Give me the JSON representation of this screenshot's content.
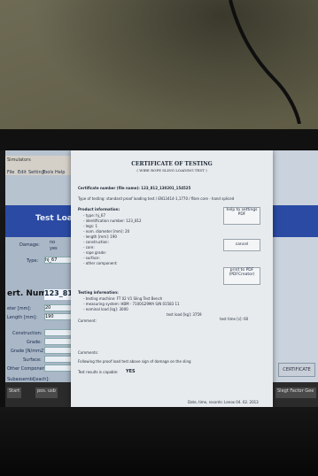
{
  "scene": {
    "app_title": "Simulators"
  },
  "background_app": {
    "toolbar_menu": [
      "File",
      "Edit",
      "Setting",
      "Tools",
      "Help"
    ],
    "heading": "Test Loa",
    "labels": [
      "Damage:",
      "Type:",
      "ert. Number:",
      "eter [mm]:",
      "Length [mm]:",
      "Construction:",
      "Grade:",
      "Grade [N/mm2]:",
      "Surface:",
      "Other Component:",
      "Subassembl[each]:"
    ],
    "damage_options": [
      "no",
      "yes"
    ],
    "type_value": "hj_67",
    "cert_number": "123_812",
    "diameter_value": "20",
    "length_value": "190",
    "taskbar_items": [
      "Start",
      "pos. usb"
    ],
    "right_button": "CERTIFICATE",
    "right_corner": "Slegt Factor Gee"
  },
  "dialog": {
    "title": "CERTIFICATE OF TESTING",
    "subtitle": "( WIRE ROPE SLING LOADING TEST )",
    "cert_line": "Certificate number (file name): 123_812_130201_154525",
    "test_type": "Type of testing: standard proof loading test     / EN13414-1,1770 / fibre core - hand spliced",
    "product_header": "Product information:",
    "product_lines": [
      "- type: hj_67",
      "- identification number: 123_812",
      "- legs: 1",
      "- nom. diameter [mm]: 20",
      "- length [mm]: 190",
      "- construction:",
      "- core:",
      "- rope grade:",
      "- surface:",
      "- other component:"
    ],
    "testing_header": "Testing information:",
    "testing_lines": [
      "- testing machine: FT 02 V1 Sling Test Bench",
      "- measuring system: HBM - 7100G29MA S/N 01583 11",
      "- nominal load [kg]: 3000"
    ],
    "test_load": "test load [kg]: 3759",
    "test_time": "test time [s]: 60",
    "comment_label": "Comment:",
    "comments_label": "Comments:",
    "damage_note": "Following the proof load test above sign of damage on the sling",
    "test_result_label": "Test results is capable:",
    "test_result": "YES",
    "footer": "Date, time, records: Lenox 04. 02. 2013",
    "buttons": {
      "help": "help to settings PDF",
      "cancel": "cancel",
      "print": "print to PDF (PDFCreator)"
    }
  }
}
